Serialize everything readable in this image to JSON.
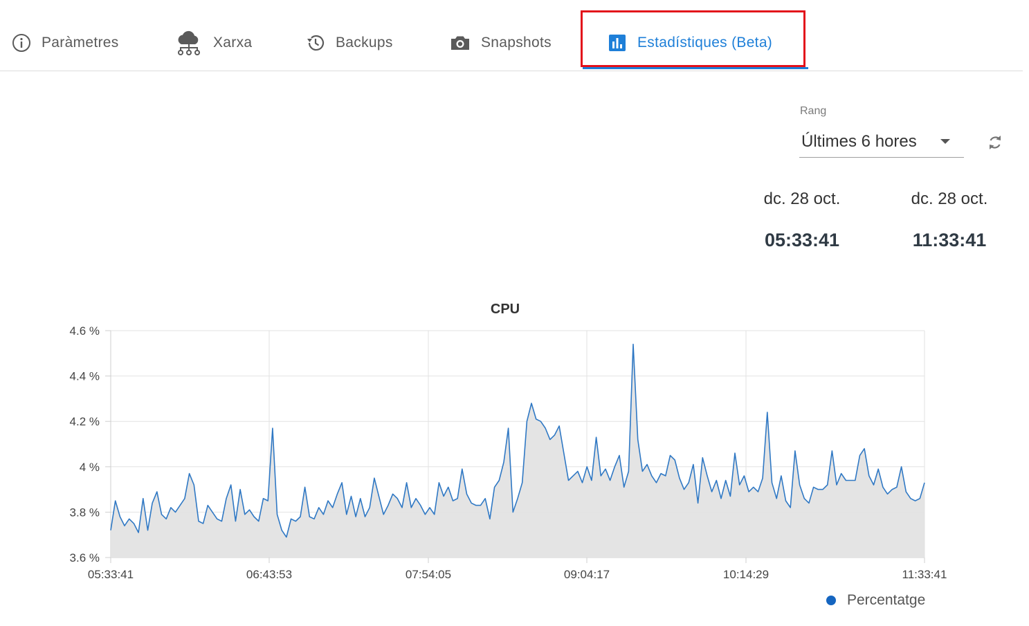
{
  "tabs": [
    {
      "label": "Paràmetres",
      "icon": "info-icon"
    },
    {
      "label": "Xarxa",
      "icon": "cloud-network-icon"
    },
    {
      "label": "Backups",
      "icon": "history-icon"
    },
    {
      "label": "Snapshots",
      "icon": "camera-icon"
    },
    {
      "label": "Estadístiques (Beta)",
      "icon": "bar-chart-icon",
      "active": true
    }
  ],
  "range": {
    "label": "Rang",
    "value": "Últimes 6 hores"
  },
  "period": {
    "start": {
      "date": "dc. 28 oct.",
      "time": "05:33:41"
    },
    "end": {
      "date": "dc. 28 oct.",
      "time": "11:33:41"
    }
  },
  "colors": {
    "accent": "#1e7fd8",
    "highlight": "#e3111b",
    "series_line": "#2f78c4",
    "series_fill": "#e3e3e3"
  },
  "chart_data": {
    "type": "area",
    "title": "CPU",
    "xlabel": "",
    "ylabel": "",
    "x_ticks": [
      "05:33:41",
      "06:43:53",
      "07:54:05",
      "09:04:17",
      "10:14:29",
      "11:33:41"
    ],
    "y_ticks": [
      "4.6 %",
      "4.4 %",
      "4.2 %",
      "4 %",
      "3.8 %",
      "3.6 %"
    ],
    "ylim": [
      3.6,
      4.6
    ],
    "grid": true,
    "legend_position": "bottom-right",
    "series": [
      {
        "name": "Percentatge",
        "x_range": [
          "05:33:41",
          "11:33:41"
        ],
        "values": [
          3.72,
          3.85,
          3.78,
          3.74,
          3.77,
          3.75,
          3.71,
          3.86,
          3.72,
          3.84,
          3.89,
          3.79,
          3.77,
          3.82,
          3.8,
          3.83,
          3.86,
          3.97,
          3.92,
          3.76,
          3.75,
          3.83,
          3.8,
          3.77,
          3.76,
          3.86,
          3.92,
          3.76,
          3.9,
          3.79,
          3.81,
          3.78,
          3.76,
          3.86,
          3.85,
          4.17,
          3.79,
          3.72,
          3.69,
          3.77,
          3.76,
          3.78,
          3.91,
          3.78,
          3.77,
          3.82,
          3.79,
          3.85,
          3.82,
          3.88,
          3.93,
          3.79,
          3.87,
          3.78,
          3.86,
          3.78,
          3.82,
          3.95,
          3.87,
          3.79,
          3.83,
          3.88,
          3.86,
          3.82,
          3.93,
          3.82,
          3.86,
          3.83,
          3.79,
          3.82,
          3.79,
          3.93,
          3.87,
          3.91,
          3.85,
          3.86,
          3.99,
          3.88,
          3.84,
          3.83,
          3.83,
          3.86,
          3.77,
          3.91,
          3.94,
          4.02,
          4.17,
          3.8,
          3.86,
          3.93,
          4.2,
          4.28,
          4.21,
          4.2,
          4.17,
          4.12,
          4.14,
          4.18,
          4.06,
          3.94,
          3.96,
          3.98,
          3.93,
          4.0,
          3.94,
          4.13,
          3.96,
          3.99,
          3.94,
          4.0,
          4.05,
          3.91,
          3.98,
          4.54,
          4.12,
          3.98,
          4.01,
          3.96,
          3.93,
          3.97,
          3.96,
          4.05,
          4.03,
          3.95,
          3.9,
          3.93,
          4.01,
          3.84,
          4.04,
          3.96,
          3.89,
          3.94,
          3.86,
          3.94,
          3.87,
          4.06,
          3.92,
          3.96,
          3.89,
          3.91,
          3.89,
          3.95,
          4.24,
          3.93,
          3.86,
          3.96,
          3.85,
          3.82,
          4.07,
          3.92,
          3.86,
          3.84,
          3.91,
          3.9,
          3.9,
          3.92,
          4.07,
          3.92,
          3.97,
          3.94,
          3.94,
          3.94,
          4.05,
          4.08,
          3.96,
          3.92,
          3.99,
          3.91,
          3.88,
          3.9,
          3.91,
          4.0,
          3.89,
          3.86,
          3.85,
          3.86,
          3.93
        ]
      }
    ]
  }
}
